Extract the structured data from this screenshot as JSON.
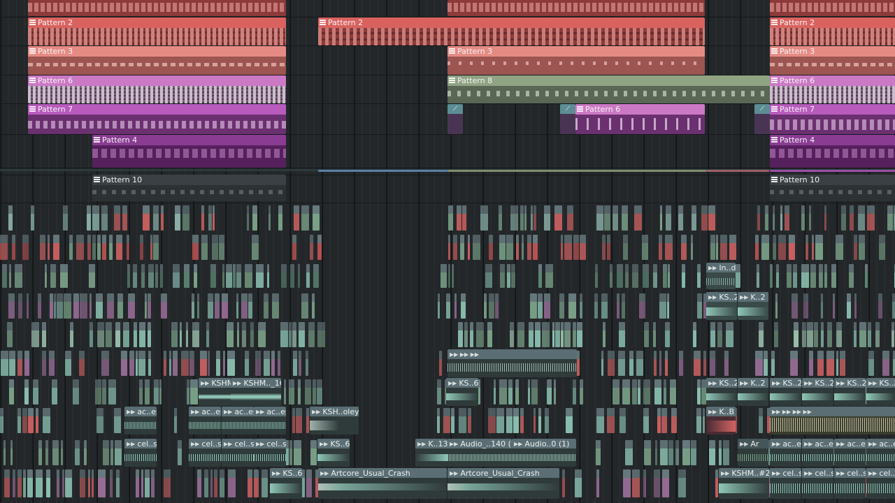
{
  "app": "FL Studio Playlist",
  "colors": {
    "pattern_red": "#d9625f",
    "pattern_salmon": "#e58b84",
    "pattern_pink": "#cc79c5",
    "pattern_magenta": "#b85bbd",
    "pattern_purple": "#8a3c93",
    "pattern_sage": "#90a383",
    "pattern_dark": "#3a4043",
    "audio_teal": "#8fc6b6",
    "audio_red": "#d46464",
    "audio_green": "#7fa78d",
    "header_slate": "#5a6e74"
  },
  "patterns": {
    "pattern2": "Pattern 2",
    "pattern3": "Pattern 3",
    "pattern4": "Pattern 4",
    "pattern6": "Pattern 6",
    "pattern7": "Pattern 7",
    "pattern8": "Pattern 8",
    "pattern10": "Pattern 10"
  },
  "audio_labels": {
    "ksh_2": "KS..2",
    "k_2": "K..2",
    "in_d": "In..d",
    "kshm": "KSHM.",
    "kshm_16": "KSHM.._16",
    "ks_6": "KS..6",
    "k_b": "K..B",
    "ksh_oley": "KSH..oley",
    "ac_es": "ac..es",
    "cel_s": "cel..s",
    "k_13": "K..13",
    "audio_140": "Audio_..140 (1)",
    "audio_0": "Audio..0 (1)",
    "ar": "Ar",
    "artcore": "Artcore_Usual_Crash",
    "kshm_2": "KSHM..#2"
  }
}
